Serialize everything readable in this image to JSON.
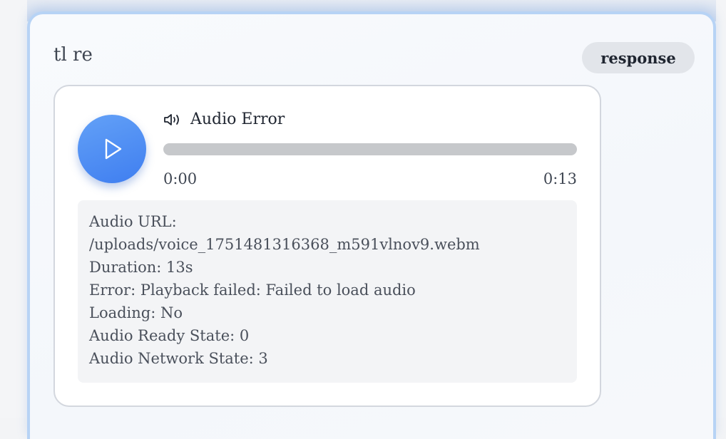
{
  "message": {
    "sender": "tl re",
    "badge": "response"
  },
  "player": {
    "title": "Audio Error",
    "current_time": "0:00",
    "total_time": "0:13",
    "progress_fraction": 0,
    "debug": {
      "url_label": "Audio URL:",
      "url_value": "/uploads/voice_1751481316368_m591vlnov9.webm",
      "duration": "Duration: 13s",
      "error": "Error: Playback failed: Failed to load audio",
      "loading": "Loading: No",
      "ready_state": "Audio Ready State: 0",
      "network_state": "Audio Network State: 3"
    },
    "icons": {
      "play": "play-icon",
      "speaker": "speaker-icon"
    }
  },
  "colors": {
    "accent": "#4a86f2",
    "card_border": "#b7d3f5",
    "badge_bg": "#e2e5ea"
  }
}
